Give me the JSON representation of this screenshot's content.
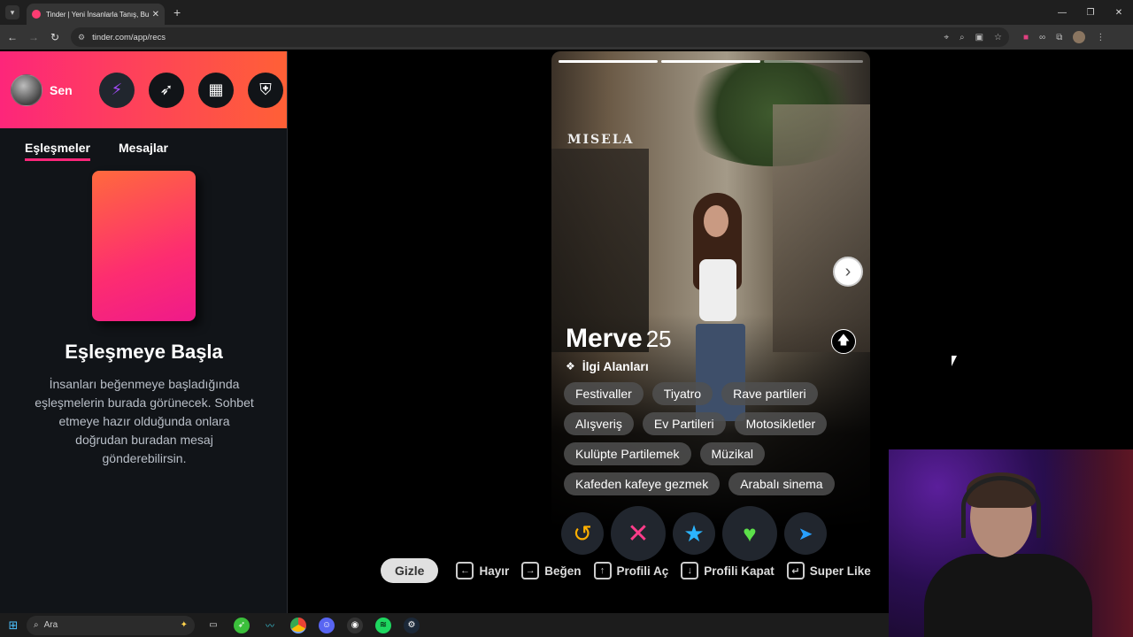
{
  "browser": {
    "tab_title": "Tinder | Yeni İnsanlarla Tanış, Bu",
    "url": "tinder.com/app/recs"
  },
  "sidebar": {
    "user_name": "Sen",
    "tabs": [
      {
        "label": "Eşleşmeler",
        "active": true
      },
      {
        "label": "Mesajlar",
        "active": false
      }
    ],
    "empty_title": "Eşleşmeye Başla",
    "empty_desc": "İnsanları beğenmeye başladığında eşleşmelerin burada görünecek. Sohbet etmeye hazır olduğunda onlara doğrudan buradan mesaj gönderebilirsin."
  },
  "profile": {
    "name": "Merve",
    "age": "25",
    "shop_sign": "MISELA",
    "interests_label": "İlgi Alanları",
    "interests": [
      "Festivaller",
      "Tiyatro",
      "Rave partileri",
      "Alışveriş",
      "Ev Partileri",
      "Motosikletler",
      "Kulüpte Partilemek",
      "Müzikal",
      "Kafeden kafeye gezmek",
      "Arabalı sinema"
    ],
    "photo_count": 3,
    "photo_index": 2
  },
  "hints": {
    "hide": "Gizle",
    "nope": "Hayır",
    "like": "Beğen",
    "open_profile": "Profili Aç",
    "close_profile": "Profili Kapat",
    "super_like": "Super Like"
  },
  "taskbar": {
    "search_placeholder": "Ara"
  },
  "colors": {
    "brand_start": "#fd267a",
    "brand_end": "#ff6036"
  }
}
